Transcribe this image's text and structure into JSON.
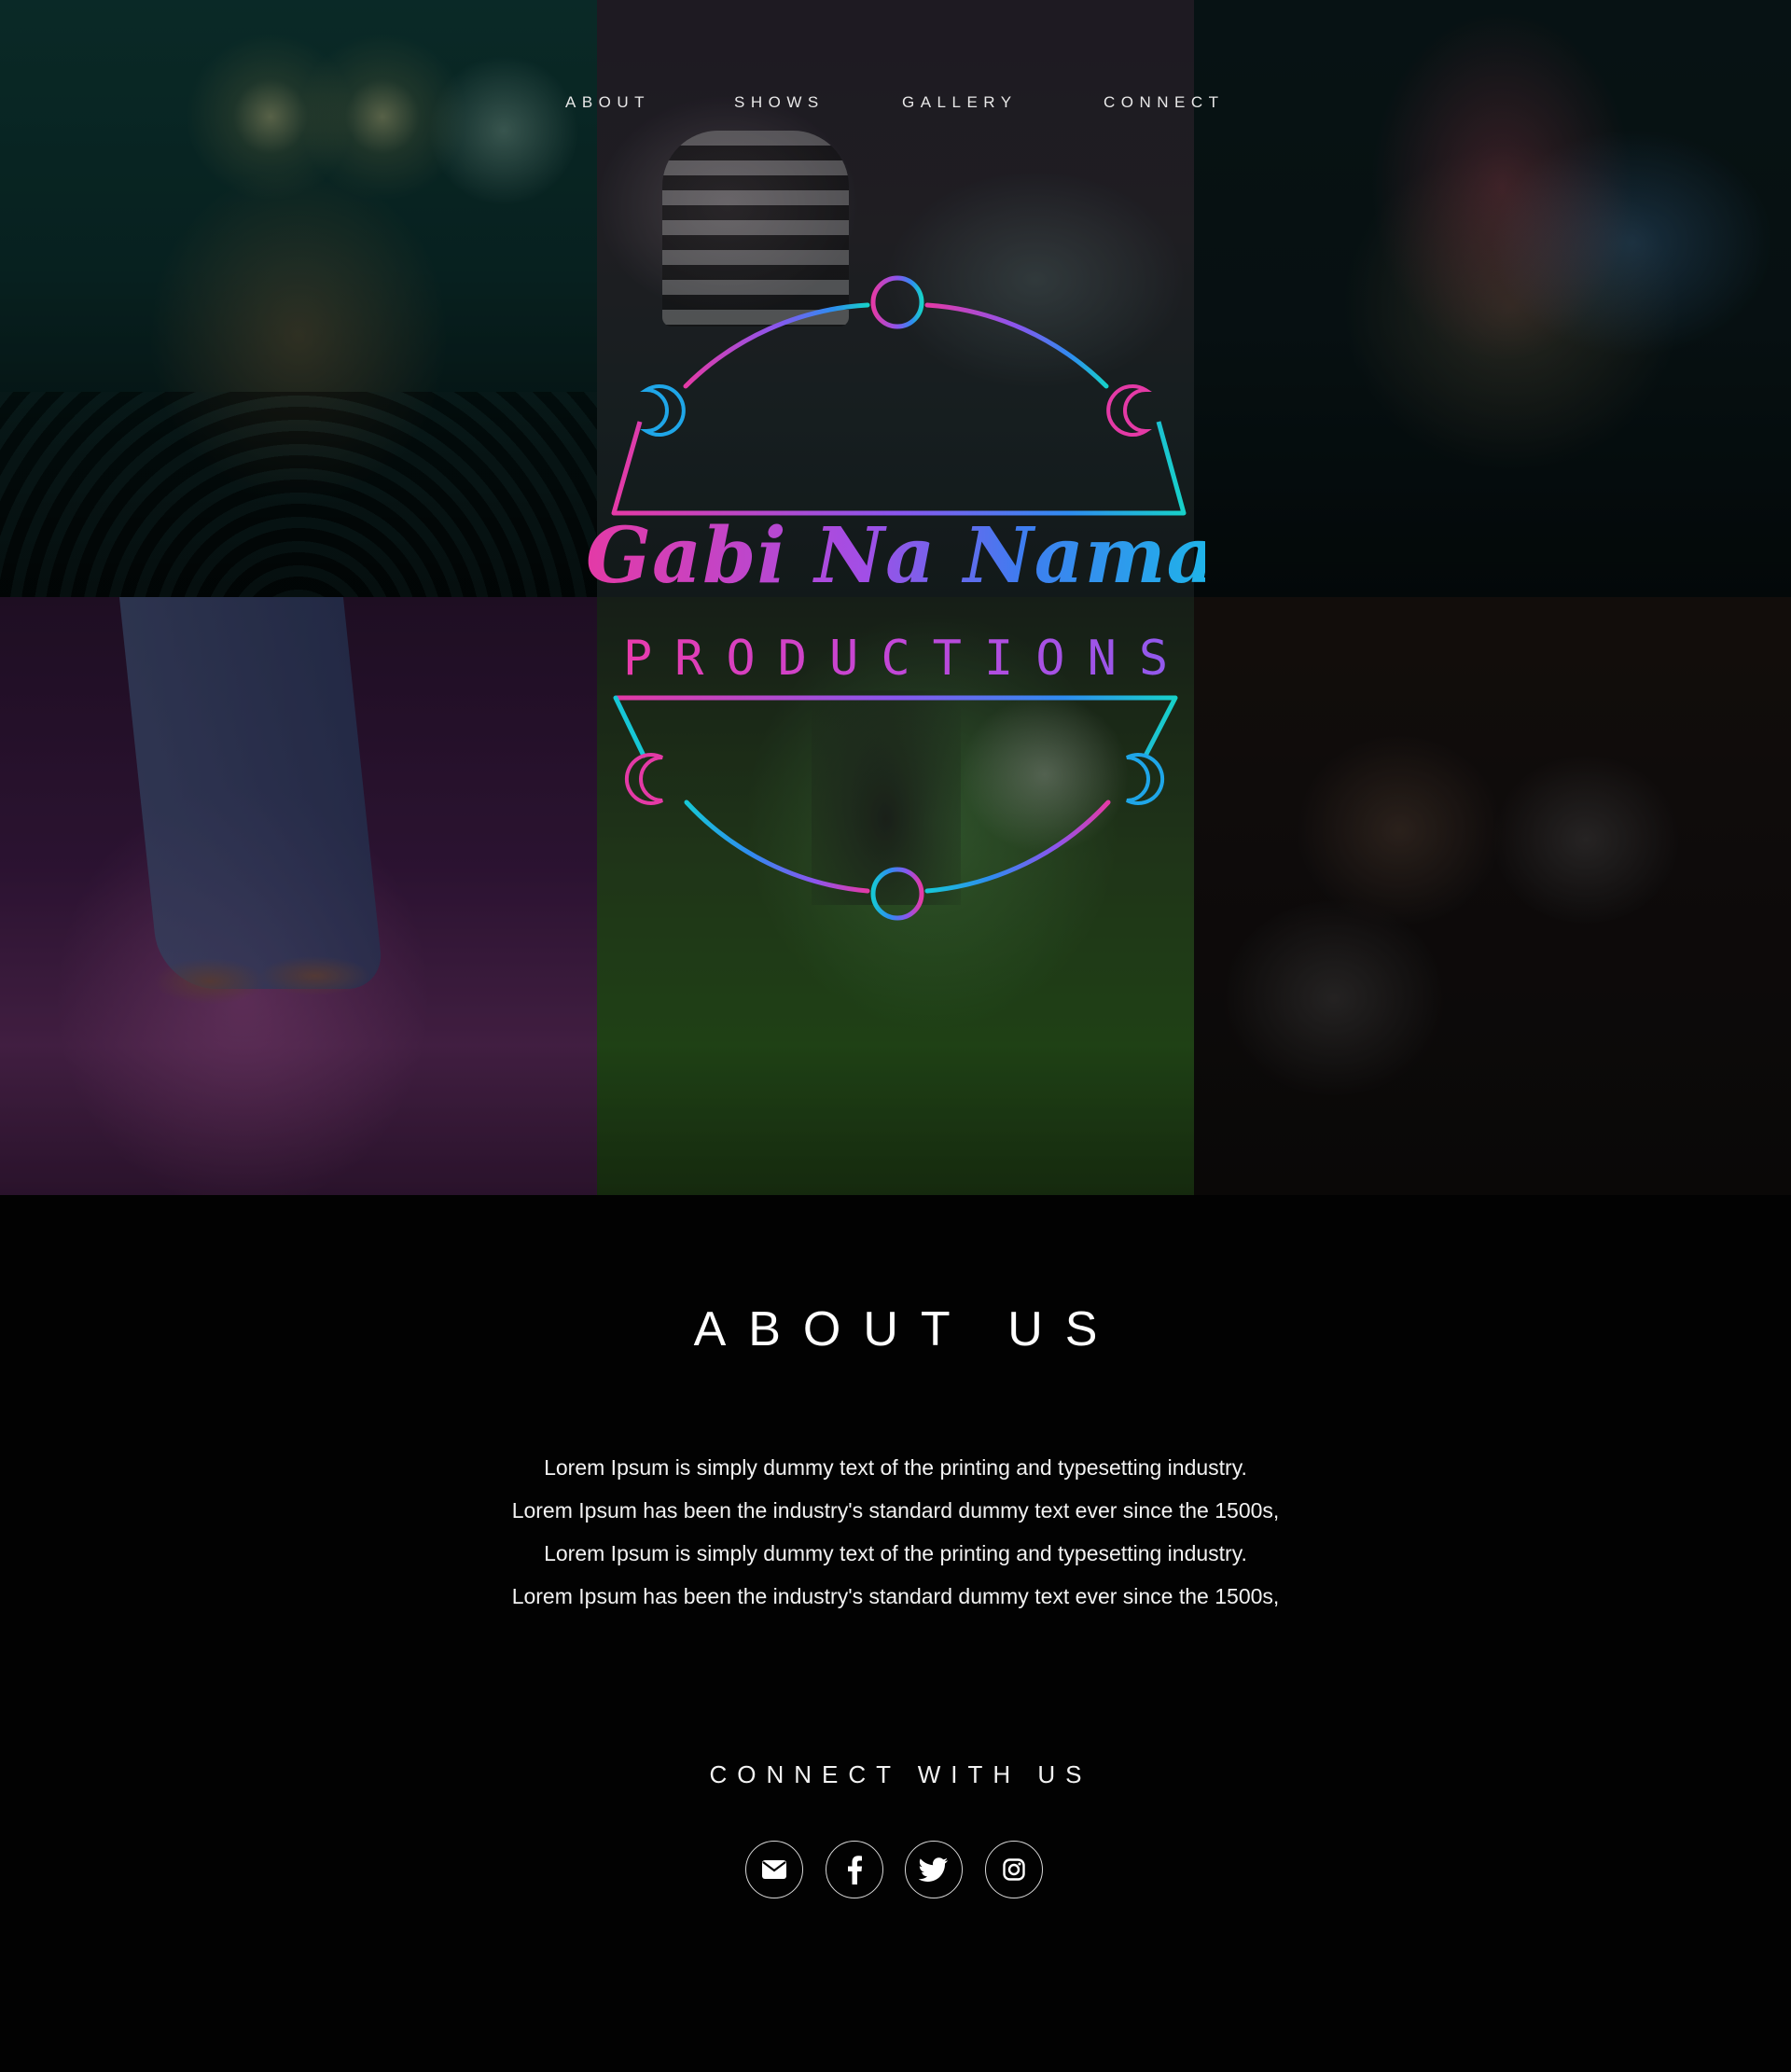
{
  "nav": {
    "items": [
      {
        "label": "ABOUT"
      },
      {
        "label": "SHOWS"
      },
      {
        "label": "GALLERY"
      },
      {
        "label": "CONNECT"
      }
    ]
  },
  "logo": {
    "script_text": "Gabi Na Naman",
    "sub_text": "PRODUCTIONS",
    "gradient_colors": [
      "#e43aa6",
      "#a24ee6",
      "#3f7cf0",
      "#1fb3e9",
      "#17d1c9"
    ]
  },
  "about": {
    "title": "ABOUT US",
    "lines": [
      "Lorem Ipsum is simply dummy text of the printing and typesetting industry.",
      "Lorem Ipsum has been the industry's standard dummy text ever since the 1500s,",
      "Lorem Ipsum is simply dummy text of the printing and typesetting industry.",
      "Lorem Ipsum has been the industry's standard dummy text ever since the 1500s,"
    ]
  },
  "connect": {
    "title": "CONNECT WITH US",
    "icons": [
      "envelope-icon",
      "facebook-icon",
      "twitter-icon",
      "instagram-icon"
    ]
  },
  "colors": {
    "background": "#020202",
    "text": "#ffffff",
    "icon_border": "#d8d8d8"
  }
}
